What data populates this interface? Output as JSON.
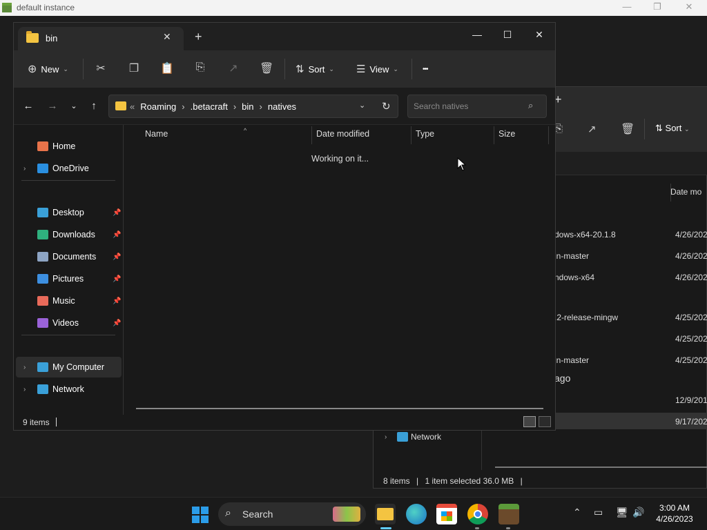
{
  "bg_window": {
    "title": "default instance",
    "controls": {
      "minimize": "—",
      "maximize": "❐",
      "close": "✕"
    }
  },
  "back_window": {
    "column_header": "Date mo",
    "rows": [
      {
        "name": "dows-x64-20.1.8",
        "date": "4/26/202"
      },
      {
        "name": "in-master",
        "date": "4/26/202"
      },
      {
        "name": "ndows-x64",
        "date": "4/26/202"
      },
      {
        "name": ".2-release-mingw",
        "date": "4/25/202"
      },
      {
        "name": "",
        "date": "4/25/202"
      },
      {
        "name": "in-master",
        "date": "4/25/202"
      },
      {
        "name": "ago",
        "date": ""
      },
      {
        "name": "",
        "date": "12/9/201"
      },
      {
        "name": "",
        "date": "9/17/202"
      }
    ],
    "sidebar_network": "Network",
    "toolbar_sort": "Sort",
    "status": {
      "items": "8 items",
      "selected": "1 item selected",
      "size": "36.0 MB"
    }
  },
  "window": {
    "tab_title": "bin",
    "controls": {
      "minimize": "—",
      "maximize": "☐",
      "close": "✕"
    },
    "toolbar": {
      "new_label": "New",
      "sort_label": "Sort",
      "view_label": "View",
      "more_label": "•••"
    },
    "breadcrumbs": [
      "Roaming",
      ".betacraft",
      "bin",
      "natives"
    ],
    "breadcrumb_overflow": "«",
    "search_placeholder": "Search natives",
    "sidebar": {
      "top": [
        {
          "label": "Home",
          "icon": "home-icon",
          "color": "#e8734a"
        },
        {
          "label": "OneDrive",
          "icon": "onedrive-icon",
          "color": "#2a8fe0"
        }
      ],
      "pinned": [
        {
          "label": "Desktop",
          "icon": "desktop-icon",
          "color": "#3aa0d8"
        },
        {
          "label": "Downloads",
          "icon": "downloads-icon",
          "color": "#2fb07e"
        },
        {
          "label": "Documents",
          "icon": "documents-icon",
          "color": "#8da4c4"
        },
        {
          "label": "Pictures",
          "icon": "pictures-icon",
          "color": "#3d8fe0"
        },
        {
          "label": "Music",
          "icon": "music-icon",
          "color": "#e86a5a"
        },
        {
          "label": "Videos",
          "icon": "videos-icon",
          "color": "#9a62d8"
        }
      ],
      "bottom": [
        {
          "label": "My Computer",
          "icon": "computer-icon",
          "color": "#3aa0d8"
        },
        {
          "label": "Network",
          "icon": "network-icon",
          "color": "#3aa0d8"
        }
      ]
    },
    "columns": [
      "Name",
      "Date modified",
      "Type",
      "Size"
    ],
    "loading_text": "Working on it...",
    "status": {
      "items": "9 items"
    }
  },
  "taskbar": {
    "search_label": "Search",
    "clock": {
      "time": "3:00 AM",
      "date": "4/26/2023"
    }
  }
}
